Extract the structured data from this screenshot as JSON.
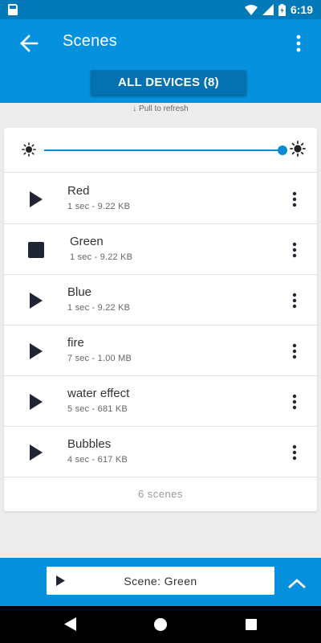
{
  "status_bar": {
    "time": "6:19"
  },
  "app_bar": {
    "title": "Scenes",
    "devices_button": "ALL DEVICES (8)"
  },
  "pull_hint": "↓ Pull to refresh",
  "brightness": {
    "level": 1.0
  },
  "scenes": [
    {
      "name": "Red",
      "meta": "1 sec - 9.22 KB",
      "state": "play"
    },
    {
      "name": "Green",
      "meta": "1 sec - 9.22 KB",
      "state": "stop"
    },
    {
      "name": "Blue",
      "meta": "1 sec - 9.22 KB",
      "state": "play"
    },
    {
      "name": "fire",
      "meta": "7 sec - 1.00 MB",
      "state": "play"
    },
    {
      "name": "water effect",
      "meta": "5 sec - 681 KB",
      "state": "play"
    },
    {
      "name": "Bubbles",
      "meta": "4 sec - 617 KB",
      "state": "play"
    }
  ],
  "scene_count": "6 scenes",
  "now_playing": {
    "label": "Scene: Green"
  },
  "colors": {
    "app_bar": "#0591dd",
    "status_bar": "#0279b9",
    "accent": "#0a8ad1",
    "icon_dark": "#1f2533"
  }
}
